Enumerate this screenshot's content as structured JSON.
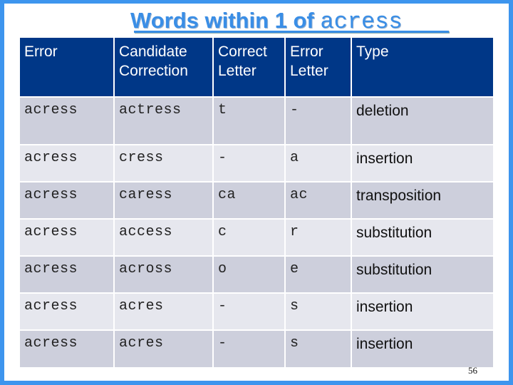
{
  "title": {
    "prefix": "Words within 1 of ",
    "word": "acress"
  },
  "colors": {
    "frame": "#3d95ee",
    "title": "#3a8ee6",
    "header_bg": "#003787",
    "row_dark": "#cdcfdc",
    "row_light": "#e6e7ee"
  },
  "table": {
    "headers": [
      "Error",
      "Candidate Correction",
      "Correct Letter",
      "Error Letter",
      "Type"
    ],
    "rows": [
      [
        "acress",
        "actress",
        "t",
        "-",
        "deletion"
      ],
      [
        "acress",
        "cress",
        "-",
        "a",
        "insertion"
      ],
      [
        "acress",
        "caress",
        "ca",
        "ac",
        "transposition"
      ],
      [
        "acress",
        "access",
        "c",
        "r",
        "substitution"
      ],
      [
        "acress",
        "across",
        "o",
        "e",
        "substitution"
      ],
      [
        "acress",
        "acres",
        "-",
        "s",
        "insertion"
      ],
      [
        "acress",
        "acres",
        "-",
        "s",
        "insertion"
      ]
    ]
  },
  "page_number": "56"
}
